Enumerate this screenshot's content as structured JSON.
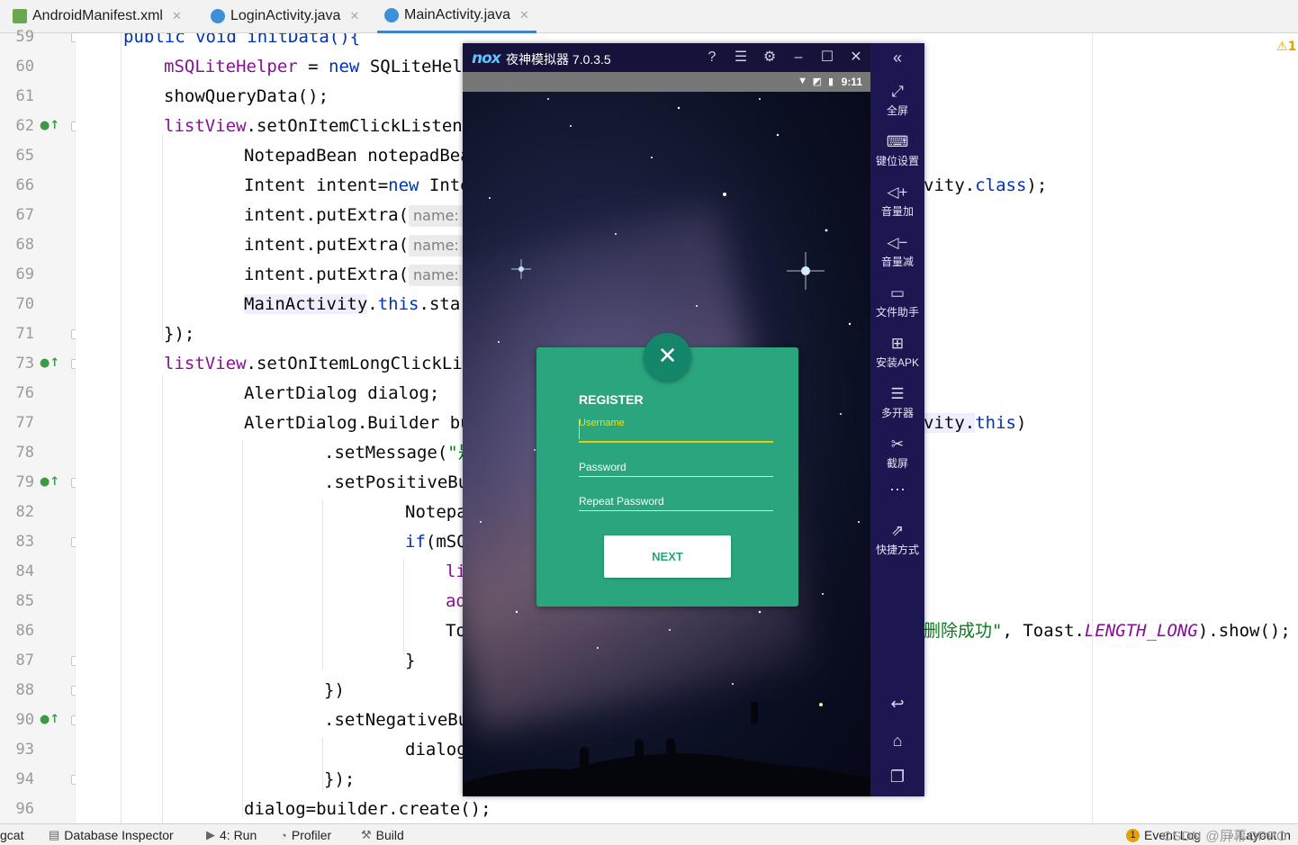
{
  "tabs": [
    {
      "label": "AndroidManifest.xml",
      "icon": "manifest-icon"
    },
    {
      "label": "LoginActivity.java",
      "icon": "java-class-icon"
    },
    {
      "label": "MainActivity.java",
      "icon": "java-class-icon"
    }
  ],
  "line_numbers": [
    "59",
    "60",
    "61",
    "62",
    "65",
    "66",
    "67",
    "68",
    "69",
    "70",
    "71",
    "73",
    "76",
    "77",
    "78",
    "79",
    "82",
    "83",
    "84",
    "85",
    "86",
    "87",
    "88",
    "90",
    "93",
    "94",
    "96"
  ],
  "code": {
    "l59": "public void initData(){",
    "l60_field": "mSQLiteHelper",
    "l60_rest": " = ",
    "l60_new": "new",
    "l60_tail": " SQLiteHelp",
    "l61": "showQueryData();",
    "l62_field": "listView",
    "l62_rest": ".setOnItemClickListene",
    "l65": "NotepadBean notepadBea",
    "l66_a": "Intent intent=",
    "l66_new": "new",
    "l66_b": " Inte",
    "l66_right_a": "vity.",
    "l66_right_kw": "class",
    "l66_right_b": ");",
    "l67": "intent.putExtra(",
    "l68": "intent.putExtra(",
    "l69": "intent.putExtra(",
    "param_hint": "name:",
    "l70_hl": "MainActivity",
    "l70_dot": ".",
    "l70_kw": "this",
    "l70_tail": ".star",
    "l71": "});",
    "l73_field": "listView",
    "l73_rest": ".setOnItemLongClickLis",
    "l76": "AlertDialog dialog;",
    "l77": "AlertDialog.Builder bu",
    "l77_right_a": "vity.",
    "l77_right_kw": "this",
    "l77_right_b": ")",
    "l78_a": ".setMessage(",
    "l78_str": "\"是",
    "l79": ".setPositiveBu",
    "l82": "Notepa",
    "l83_kw": "if",
    "l83_rest": "(mSQ",
    "l84": "li",
    "l85": "ad",
    "l86": "To",
    "l86_right_str": "删除成功\"",
    "l86_right_a": ", Toast.",
    "l86_right_it": "LENGTH_LONG",
    "l86_right_b": ").show();",
    "l87": "}",
    "l88": "})",
    "l90": ".setNegativeBu",
    "l93": "dialog",
    "l94": "});",
    "l96": "dialog=builder.create();"
  },
  "warning": {
    "glyph": "⚠",
    "count": "1"
  },
  "statusbar": {
    "logcat": "gcat",
    "db_inspector": "Database Inspector",
    "run": "4: Run",
    "profiler": "Profiler",
    "build": "Build",
    "event_log_count": "1",
    "event_log": "Event Log",
    "layout": "Layout In",
    "watermark": "CSDN @屏幕OPPO"
  },
  "emulator": {
    "logo": "nox",
    "title": "夜神模拟器 7.0.3.5",
    "clock": "9:11",
    "sidebar": [
      {
        "label": "全屏",
        "icon": "fullscreen-icon"
      },
      {
        "label": "键位设置",
        "icon": "keyboard-icon"
      },
      {
        "label": "音量加",
        "icon": "volume-up-icon"
      },
      {
        "label": "音量减",
        "icon": "volume-down-icon"
      },
      {
        "label": "文件助手",
        "icon": "file-helper-icon"
      },
      {
        "label": "安装APK",
        "icon": "install-apk-icon"
      },
      {
        "label": "多开器",
        "icon": "multi-instance-icon"
      },
      {
        "label": "截屏",
        "icon": "screenshot-icon"
      },
      {
        "label": "快捷方式",
        "icon": "shortcut-icon"
      }
    ]
  },
  "register_dialog": {
    "title": "REGISTER",
    "username_label": "Username",
    "password_label": "Password",
    "repeat_label": "Repeat Password",
    "next_label": "NEXT"
  },
  "colors": {
    "dialog_bg": "#2aa57e",
    "emulator_frame": "#17123a",
    "ide_keyword": "#0033b3",
    "ide_field": "#871094"
  }
}
